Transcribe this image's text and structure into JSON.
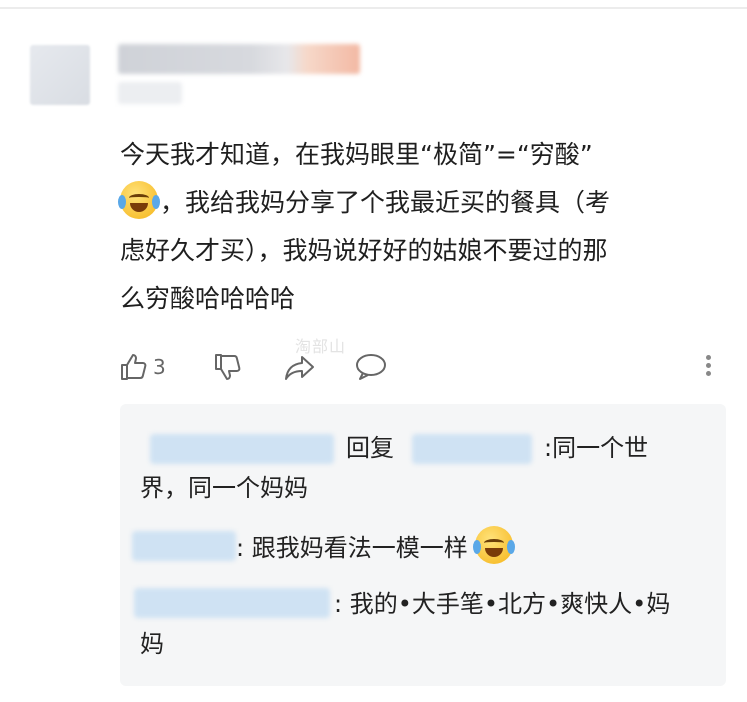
{
  "comment": {
    "text_line1": "今天我才知道，在我妈眼里“极简”=“穷酸”",
    "text_line2": "，我给我妈分享了个我最近买的餐具（考",
    "text_line3": "虑好久才买），我妈说好好的姑娘不要过的那",
    "text_line4": "么穷酸哈哈哈哈",
    "emoji": "laughing-crying-emoji"
  },
  "actions": {
    "like_count": "3",
    "icons": [
      "thumbs-up-icon",
      "thumbs-down-icon",
      "share-icon",
      "comment-icon",
      "more-icon"
    ]
  },
  "watermark": "淘部山",
  "replies": [
    {
      "label": "回复",
      "text": ":同一个世",
      "text2": "界，同一个妈妈"
    },
    {
      "text": ": 跟我妈看法一模一样"
    },
    {
      "text": ": 我的•大手笔•北方•爽快人•妈",
      "text2": "妈"
    }
  ]
}
